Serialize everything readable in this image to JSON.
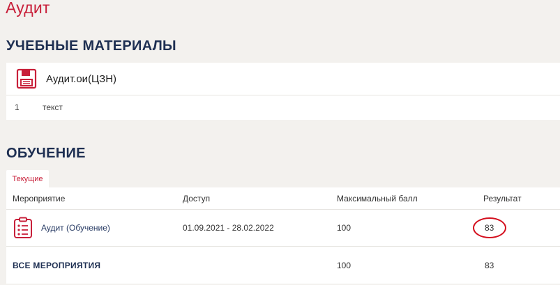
{
  "page": {
    "title": "Аудит"
  },
  "materials": {
    "heading": "УЧЕБНЫЕ МАТЕРИАЛЫ",
    "item_name": "Аудит.ои(ЦЗН)",
    "rows": [
      {
        "num": "1",
        "label": "текст"
      }
    ]
  },
  "training": {
    "heading": "ОБУЧЕНИЕ",
    "tab_label": "Текущие",
    "columns": [
      "Мероприятие",
      "Доступ",
      "Максимальный балл",
      "Результат"
    ],
    "rows": [
      {
        "event": "Аудит (Обучение)",
        "access": "01.09.2021 - 28.02.2022",
        "max": "100",
        "result": "83"
      }
    ],
    "total": {
      "label": "ВСЕ МЕРОПРИЯТИЯ",
      "max": "100",
      "result": "83"
    }
  },
  "colors": {
    "accent": "#c8203a",
    "heading": "#1e2f52",
    "annotation": "#d4101f"
  }
}
